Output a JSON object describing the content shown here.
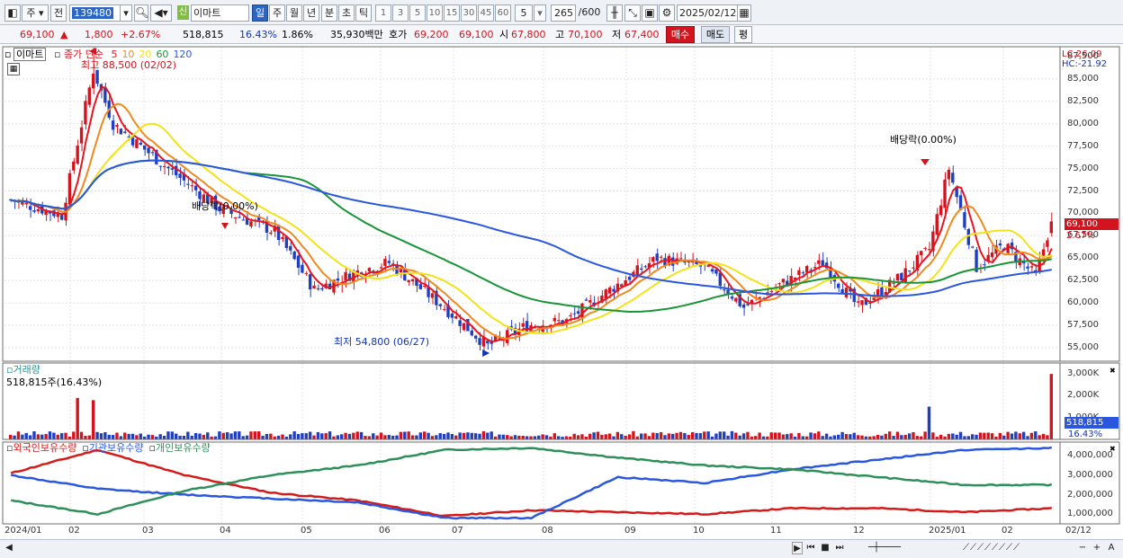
{
  "toolbar": {
    "market": "주",
    "prev": "전",
    "code": "139480",
    "stock_name": "이마트",
    "shin_label": "신",
    "periods": [
      "일",
      "주",
      "월",
      "년",
      "분",
      "초",
      "틱"
    ],
    "intervals": [
      "1",
      "3",
      "5",
      "10",
      "15",
      "30",
      "45",
      "60"
    ],
    "interval_value": "5",
    "count": "265",
    "count_max": "/600",
    "date": "2025/02/12"
  },
  "quote": {
    "price": "69,100",
    "change": "1,800",
    "change_pct": "+2.67%",
    "volume": "518,815",
    "vol_ratio": "16.43%",
    "turnover_pct": "1.86%",
    "amount": "35,930백만",
    "hoga_label": "호가",
    "bid": "69,200",
    "ask": "69,100",
    "open_label": "시",
    "open": "67,800",
    "high_label": "고",
    "high": "70,100",
    "low_label": "저",
    "low": "67,400",
    "buy_label": "매수",
    "sell_label": "매도",
    "eval_label": "평"
  },
  "price_panel": {
    "name_tag": "이마트",
    "legend_prefix": "종가 단순",
    "ma_periods": [
      "5",
      "10",
      "20",
      "60",
      "120"
    ],
    "ma_colors": [
      "#e8141e",
      "#f08a1d",
      "#f3e21a",
      "#199438",
      "#2a57de"
    ],
    "high_note": "최고 88,500 (02/02)",
    "low_note": "최저 54,800 (06/27)",
    "dividend_note": "배당락(0.00%)",
    "lc": "LC:26.09",
    "hc": "HC:-21.92",
    "price_tag": "69,100",
    "pct_tag": "2.67%",
    "y_labels": [
      "87,500",
      "85,000",
      "82,500",
      "80,000",
      "77,500",
      "75,000",
      "72,500",
      "70,000",
      "67,500",
      "65,000",
      "62,500",
      "60,000",
      "57,500",
      "55,000"
    ]
  },
  "volume_panel": {
    "title": "거래량",
    "subtitle": "518,815주(16.43%)",
    "y_labels": [
      "3,000K",
      "2,000K",
      "1,000K"
    ],
    "vol_tag": "518,815",
    "pct_tag": "16.43%"
  },
  "holding_panel": {
    "legend": [
      "외국인보유수량",
      "기관보유수량",
      "개인보유수량"
    ],
    "colors": [
      "#d51a1a",
      "#2a57de",
      "#2f8f5a"
    ],
    "y_labels": [
      "4,000,000",
      "3,000,000",
      "2,000,000",
      "1,000,000"
    ]
  },
  "x_axis": [
    "2024/01",
    "02",
    "03",
    "04",
    "05",
    "06",
    "07",
    "08",
    "09",
    "10",
    "11",
    "12",
    "2025/01",
    "02",
    "02/12"
  ],
  "chart_data": {
    "type": "candlestick",
    "x_range": [
      "2024/01",
      "2025/02/12"
    ],
    "price_ylim": [
      53500,
      88000
    ],
    "high": {
      "value": 88500,
      "date": "02/02"
    },
    "low": {
      "value": 54800,
      "date": "06/27"
    },
    "last": {
      "close": 69100,
      "open": 67800,
      "high": 70100,
      "low": 67400
    },
    "close_series": [
      [
        "2024/01",
        71500
      ],
      [
        "01/20",
        69800
      ],
      [
        "02/02",
        86000
      ],
      [
        "02/10",
        80000
      ],
      [
        "03/01",
        75000
      ],
      [
        "03/20",
        70500
      ],
      [
        "04/10",
        68000
      ],
      [
        "04/25",
        61500
      ],
      [
        "05/15",
        63500
      ],
      [
        "05/30",
        64500
      ],
      [
        "06/15",
        59500
      ],
      [
        "06/27",
        55200
      ],
      [
        "07/15",
        57500
      ],
      [
        "08/05",
        58000
      ],
      [
        "08/20",
        61500
      ],
      [
        "09/05",
        65000
      ],
      [
        "09/25",
        64000
      ],
      [
        "10/10",
        59500
      ],
      [
        "10/25",
        62000
      ],
      [
        "11/10",
        64500
      ],
      [
        "11/25",
        59500
      ],
      [
        "12/10",
        63000
      ],
      [
        "12/20",
        66000
      ],
      [
        "12/30",
        75000
      ],
      [
        "2025/01/10",
        64000
      ],
      [
        "01/20",
        66500
      ],
      [
        "02/05",
        63000
      ],
      [
        "02/12",
        69100
      ]
    ],
    "volume_ylim": [
      0,
      3500000
    ],
    "volume_spikes": [
      [
        "02/01",
        1900000
      ],
      [
        "02/02",
        1800000
      ],
      [
        "12/30",
        1500000
      ],
      [
        "02/12",
        3000000
      ]
    ],
    "holding_ylim": [
      500000,
      4700000
    ],
    "holdings": [
      {
        "name": "외국인보유수량",
        "values": [
          3100000,
          4300000,
          3000000,
          2100000,
          1700000,
          900000,
          1200000,
          1100000,
          1000000,
          1300000,
          1300000,
          1100000,
          1300000
        ]
      },
      {
        "name": "기관보유수량",
        "values": [
          3000000,
          2300000,
          2000000,
          1800000,
          1600000,
          800000,
          800000,
          2900000,
          2600000,
          3300000,
          3800000,
          4300000,
          4400000
        ]
      },
      {
        "name": "개인보유수량",
        "values": [
          1700000,
          1000000,
          2200000,
          3000000,
          3500000,
          4300000,
          4400000,
          3900000,
          3500000,
          3300000,
          2900000,
          2500000,
          2500000
        ]
      }
    ]
  }
}
